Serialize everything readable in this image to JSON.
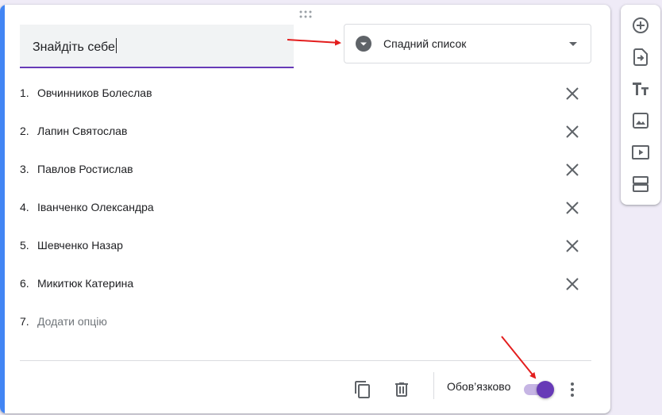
{
  "question": {
    "title": "Знайдіть себе",
    "type_label": "Спадний список"
  },
  "options": [
    {
      "number": "1.",
      "label": "Овчинников Болеслав"
    },
    {
      "number": "2.",
      "label": "Лапин Святослав"
    },
    {
      "number": "3.",
      "label": "Павлов Ростислав"
    },
    {
      "number": "4.",
      "label": "Іванченко Олександра"
    },
    {
      "number": "5.",
      "label": "Шевченко Назар"
    },
    {
      "number": "6.",
      "label": "Микитюк Катерина"
    }
  ],
  "add_option": {
    "number": "7.",
    "label": "Додати опцію"
  },
  "footer": {
    "required_label": "Обов’язково",
    "required_enabled": true
  },
  "side_toolbar": {
    "icons": [
      "add-question-icon",
      "import-questions-icon",
      "add-title-icon",
      "add-image-icon",
      "add-video-icon",
      "add-section-icon"
    ]
  },
  "colors": {
    "accent_blue": "#4285f4",
    "primary_purple": "#673ab7",
    "annotation_red": "#e31d1d",
    "icon_gray": "#5f6368"
  }
}
